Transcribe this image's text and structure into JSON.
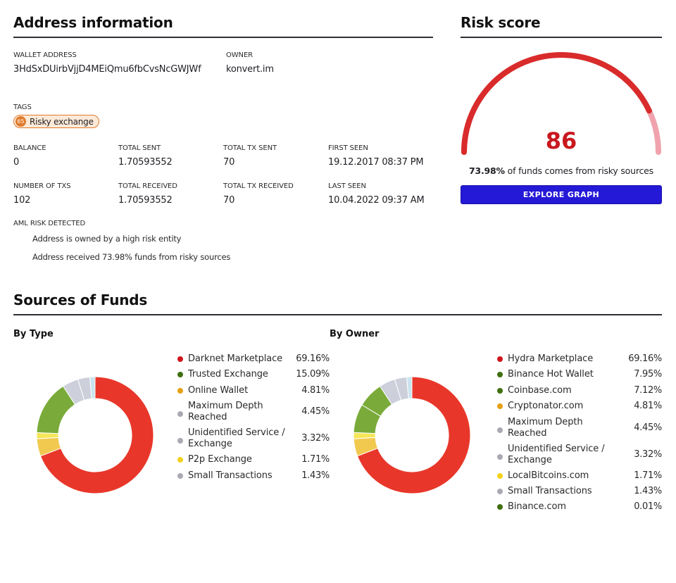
{
  "address_info": {
    "title": "Address information",
    "wallet_address_label": "WALLET ADDRESS",
    "wallet_address": "3HdSxDUirbVjjD4MEiQmu6fbCvsNcGWJWf",
    "owner_label": "OWNER",
    "owner": "konvert.im",
    "tags_label": "TAGS",
    "tag": {
      "score": "65",
      "label": "Risky exchange",
      "color": "#e07a2a"
    },
    "stats": [
      {
        "label": "BALANCE",
        "value": "0"
      },
      {
        "label": "TOTAL SENT",
        "value": "1.70593552"
      },
      {
        "label": "TOTAL TX SENT",
        "value": "70"
      },
      {
        "label": "FIRST SEEN",
        "value": "19.12.2017 08:37 PM"
      },
      {
        "label": "NUMBER OF TXS",
        "value": "102"
      },
      {
        "label": "TOTAL RECEIVED",
        "value": "1.70593552"
      },
      {
        "label": "TOTAL TX RECEIVED",
        "value": "70"
      },
      {
        "label": "LAST SEEN",
        "value": "10.04.2022 09:37 AM"
      }
    ],
    "aml_label": "AML RISK DETECTED",
    "aml_items": [
      "Address is owned by a high risk entity",
      "Address received 73.98% funds from risky sources"
    ]
  },
  "risk_score": {
    "title": "Risk score",
    "score": "86",
    "score_fraction": 0.86,
    "colors": {
      "fill": "#d92b2b",
      "track": "#f0a3ad",
      "score_text": "#c8191f"
    },
    "note_bold": "73.98%",
    "note_rest": " of funds comes from risky sources",
    "button_label": "EXPLORE GRAPH",
    "button_color": "#2419d6"
  },
  "sources": {
    "title": "Sources of Funds",
    "by_type_title": "By Type",
    "by_owner_title": "By Owner"
  },
  "chart_data": [
    {
      "type": "pie",
      "title": "By Type",
      "donut": true,
      "legend": "right",
      "categories": [
        "Darknet Marketplace",
        "Trusted Exchange",
        "Online Wallet",
        "Maximum Depth Reached",
        "Unidentified Service / Exchange",
        "P2p Exchange",
        "Small Transactions"
      ],
      "values": [
        69.16,
        15.09,
        4.81,
        4.45,
        3.32,
        1.71,
        1.43
      ],
      "labels": [
        "69.16%",
        "15.09%",
        "4.81%",
        "4.45%",
        "3.32%",
        "1.71%",
        "1.43%"
      ],
      "legend_colors": [
        "#d0161c",
        "#3f6f10",
        "#e4a017",
        "#a9a9b3",
        "#a9a9b3",
        "#f2d21c",
        "#a9a9b3"
      ],
      "slice_colors": [
        "#e8372a",
        "#7aab3a",
        "#f1c94f",
        "#cdd0db",
        "#cdd0db",
        "#f5e65a",
        "#c9e4ee"
      ],
      "slice_order_clockwise_from_top": [
        "Darknet Marketplace",
        "Online Wallet",
        "P2p Exchange",
        "Trusted Exchange",
        "Maximum Depth Reached",
        "Unidentified Service / Exchange",
        "Small Transactions"
      ]
    },
    {
      "type": "pie",
      "title": "By Owner",
      "donut": true,
      "legend": "right",
      "categories": [
        "Hydra Marketplace",
        "Binance Hot Wallet",
        "Coinbase.com",
        "Cryptonator.com",
        "Maximum Depth Reached",
        "Unidentified Service / Exchange",
        "LocalBitcoins.com",
        "Small Transactions",
        "Binance.com"
      ],
      "values": [
        69.16,
        7.95,
        7.12,
        4.81,
        4.45,
        3.32,
        1.71,
        1.43,
        0.01
      ],
      "labels": [
        "69.16%",
        "7.95%",
        "7.12%",
        "4.81%",
        "4.45%",
        "3.32%",
        "1.71%",
        "1.43%",
        "0.01%"
      ],
      "legend_colors": [
        "#d0161c",
        "#3f6f10",
        "#3f6f10",
        "#e4a017",
        "#a9a9b3",
        "#a9a9b3",
        "#f2d21c",
        "#a9a9b3",
        "#3f6f10"
      ],
      "slice_colors": [
        "#e8372a",
        "#7aab3a",
        "#7aab3a",
        "#f1c94f",
        "#cdd0db",
        "#cdd0db",
        "#f5e65a",
        "#c9e4ee",
        "#7aab3a"
      ],
      "slice_order_clockwise_from_top": [
        "Hydra Marketplace",
        "Cryptonator.com",
        "LocalBitcoins.com",
        "Binance Hot Wallet",
        "Coinbase.com",
        "Maximum Depth Reached",
        "Unidentified Service / Exchange",
        "Small Transactions",
        "Binance.com"
      ]
    }
  ]
}
